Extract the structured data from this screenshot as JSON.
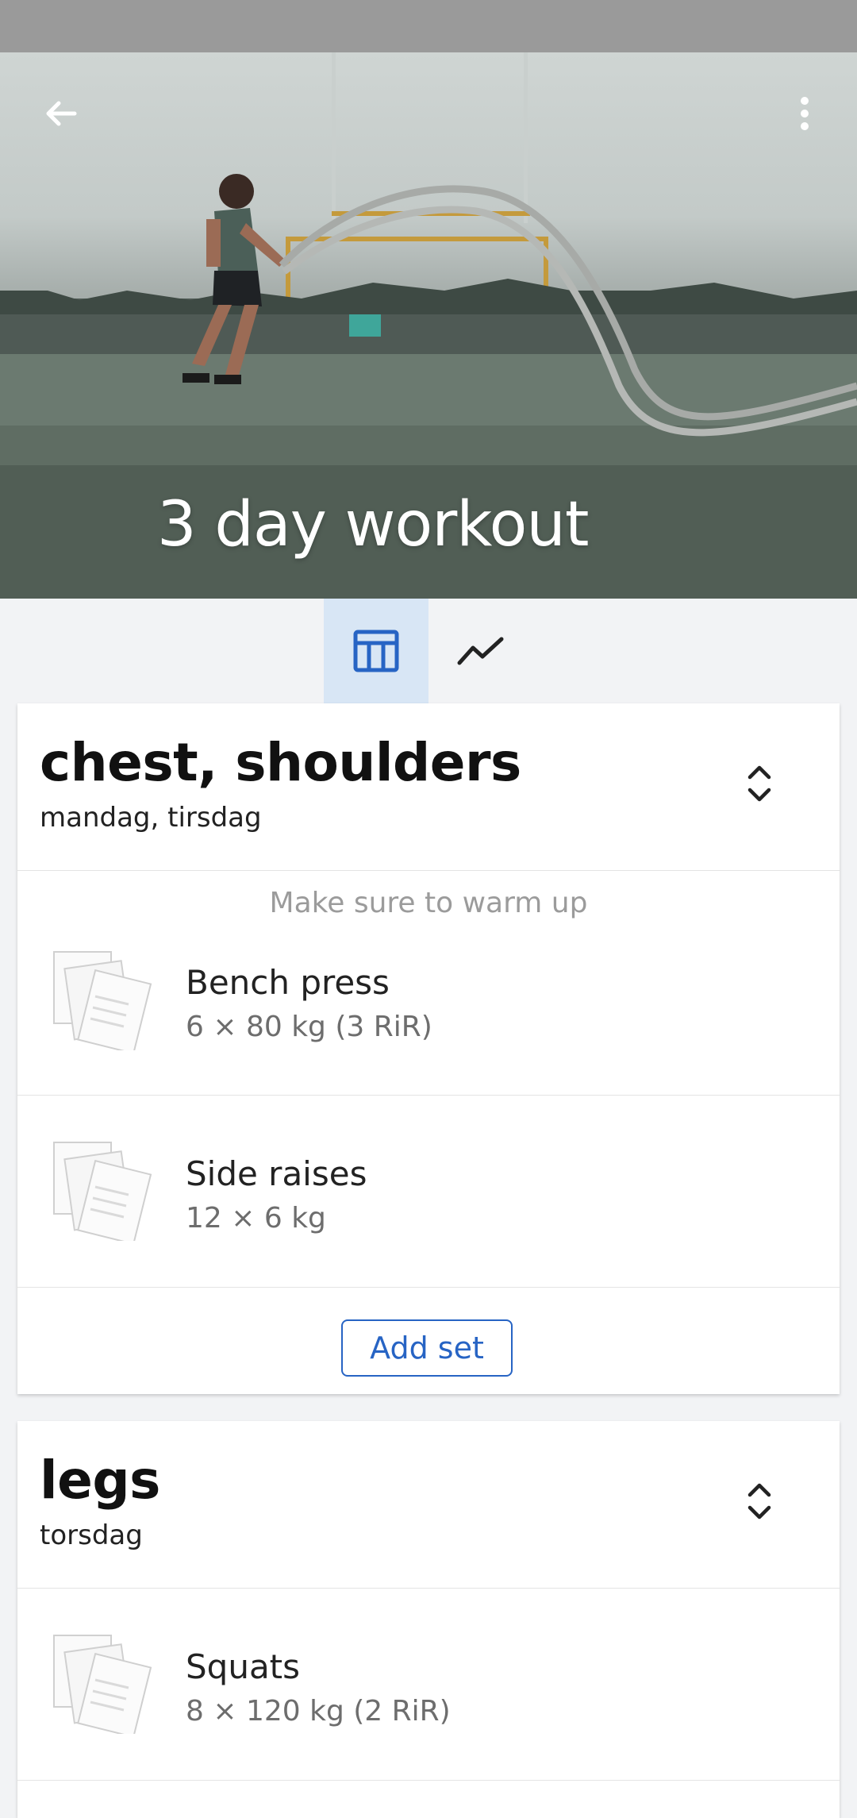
{
  "header": {
    "title": "3 day workout",
    "back_icon": "arrow-left-icon",
    "menu_icon": "more-vert-icon"
  },
  "tabs": [
    {
      "icon": "table-icon",
      "active": true
    },
    {
      "icon": "trend-line-icon",
      "active": false
    }
  ],
  "colors": {
    "accent": "#2764c4",
    "active_tab_bg": "#d8e6f5",
    "background": "#f2f3f5"
  },
  "routines": [
    {
      "name": "chest, shoulders",
      "days": "mandag, tirsdag",
      "note": "Make sure to warm up",
      "exercises": [
        {
          "name": "Bench press",
          "detail": "6 × 80 kg  (3 RiR)"
        },
        {
          "name": "Side raises",
          "detail": "12 × 6 kg"
        }
      ],
      "add_label": "Add set"
    },
    {
      "name": "legs",
      "days": "torsdag",
      "exercises": [
        {
          "name": "Squats",
          "detail": "8 × 120 kg  (2 RiR)"
        }
      ]
    }
  ]
}
